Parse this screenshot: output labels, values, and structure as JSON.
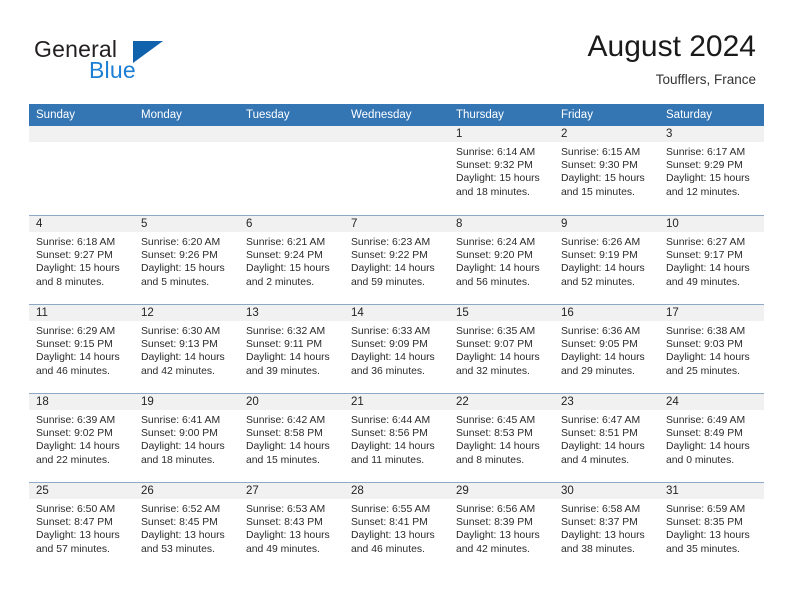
{
  "brand": {
    "name_part1": "General",
    "name_part2": "Blue",
    "logo_icon": "triangle-logo-icon",
    "accent_color": "#1c7fd4",
    "triangle_color": "#1162ad"
  },
  "header": {
    "title": "August 2024",
    "subtitle": "Toufflers, France"
  },
  "calendar": {
    "header_color": "#3475b4",
    "day_number_band_color": "#f1f1f1",
    "weekday_headers": [
      "Sunday",
      "Monday",
      "Tuesday",
      "Wednesday",
      "Thursday",
      "Friday",
      "Saturday"
    ],
    "weeks": [
      [
        {
          "date": "",
          "lines": []
        },
        {
          "date": "",
          "lines": []
        },
        {
          "date": "",
          "lines": []
        },
        {
          "date": "",
          "lines": []
        },
        {
          "date": "1",
          "lines": [
            "Sunrise: 6:14 AM",
            "Sunset: 9:32 PM",
            "Daylight: 15 hours",
            "and 18 minutes."
          ]
        },
        {
          "date": "2",
          "lines": [
            "Sunrise: 6:15 AM",
            "Sunset: 9:30 PM",
            "Daylight: 15 hours",
            "and 15 minutes."
          ]
        },
        {
          "date": "3",
          "lines": [
            "Sunrise: 6:17 AM",
            "Sunset: 9:29 PM",
            "Daylight: 15 hours",
            "and 12 minutes."
          ]
        }
      ],
      [
        {
          "date": "4",
          "lines": [
            "Sunrise: 6:18 AM",
            "Sunset: 9:27 PM",
            "Daylight: 15 hours",
            "and 8 minutes."
          ]
        },
        {
          "date": "5",
          "lines": [
            "Sunrise: 6:20 AM",
            "Sunset: 9:26 PM",
            "Daylight: 15 hours",
            "and 5 minutes."
          ]
        },
        {
          "date": "6",
          "lines": [
            "Sunrise: 6:21 AM",
            "Sunset: 9:24 PM",
            "Daylight: 15 hours",
            "and 2 minutes."
          ]
        },
        {
          "date": "7",
          "lines": [
            "Sunrise: 6:23 AM",
            "Sunset: 9:22 PM",
            "Daylight: 14 hours",
            "and 59 minutes."
          ]
        },
        {
          "date": "8",
          "lines": [
            "Sunrise: 6:24 AM",
            "Sunset: 9:20 PM",
            "Daylight: 14 hours",
            "and 56 minutes."
          ]
        },
        {
          "date": "9",
          "lines": [
            "Sunrise: 6:26 AM",
            "Sunset: 9:19 PM",
            "Daylight: 14 hours",
            "and 52 minutes."
          ]
        },
        {
          "date": "10",
          "lines": [
            "Sunrise: 6:27 AM",
            "Sunset: 9:17 PM",
            "Daylight: 14 hours",
            "and 49 minutes."
          ]
        }
      ],
      [
        {
          "date": "11",
          "lines": [
            "Sunrise: 6:29 AM",
            "Sunset: 9:15 PM",
            "Daylight: 14 hours",
            "and 46 minutes."
          ]
        },
        {
          "date": "12",
          "lines": [
            "Sunrise: 6:30 AM",
            "Sunset: 9:13 PM",
            "Daylight: 14 hours",
            "and 42 minutes."
          ]
        },
        {
          "date": "13",
          "lines": [
            "Sunrise: 6:32 AM",
            "Sunset: 9:11 PM",
            "Daylight: 14 hours",
            "and 39 minutes."
          ]
        },
        {
          "date": "14",
          "lines": [
            "Sunrise: 6:33 AM",
            "Sunset: 9:09 PM",
            "Daylight: 14 hours",
            "and 36 minutes."
          ]
        },
        {
          "date": "15",
          "lines": [
            "Sunrise: 6:35 AM",
            "Sunset: 9:07 PM",
            "Daylight: 14 hours",
            "and 32 minutes."
          ]
        },
        {
          "date": "16",
          "lines": [
            "Sunrise: 6:36 AM",
            "Sunset: 9:05 PM",
            "Daylight: 14 hours",
            "and 29 minutes."
          ]
        },
        {
          "date": "17",
          "lines": [
            "Sunrise: 6:38 AM",
            "Sunset: 9:03 PM",
            "Daylight: 14 hours",
            "and 25 minutes."
          ]
        }
      ],
      [
        {
          "date": "18",
          "lines": [
            "Sunrise: 6:39 AM",
            "Sunset: 9:02 PM",
            "Daylight: 14 hours",
            "and 22 minutes."
          ]
        },
        {
          "date": "19",
          "lines": [
            "Sunrise: 6:41 AM",
            "Sunset: 9:00 PM",
            "Daylight: 14 hours",
            "and 18 minutes."
          ]
        },
        {
          "date": "20",
          "lines": [
            "Sunrise: 6:42 AM",
            "Sunset: 8:58 PM",
            "Daylight: 14 hours",
            "and 15 minutes."
          ]
        },
        {
          "date": "21",
          "lines": [
            "Sunrise: 6:44 AM",
            "Sunset: 8:56 PM",
            "Daylight: 14 hours",
            "and 11 minutes."
          ]
        },
        {
          "date": "22",
          "lines": [
            "Sunrise: 6:45 AM",
            "Sunset: 8:53 PM",
            "Daylight: 14 hours",
            "and 8 minutes."
          ]
        },
        {
          "date": "23",
          "lines": [
            "Sunrise: 6:47 AM",
            "Sunset: 8:51 PM",
            "Daylight: 14 hours",
            "and 4 minutes."
          ]
        },
        {
          "date": "24",
          "lines": [
            "Sunrise: 6:49 AM",
            "Sunset: 8:49 PM",
            "Daylight: 14 hours",
            "and 0 minutes."
          ]
        }
      ],
      [
        {
          "date": "25",
          "lines": [
            "Sunrise: 6:50 AM",
            "Sunset: 8:47 PM",
            "Daylight: 13 hours",
            "and 57 minutes."
          ]
        },
        {
          "date": "26",
          "lines": [
            "Sunrise: 6:52 AM",
            "Sunset: 8:45 PM",
            "Daylight: 13 hours",
            "and 53 minutes."
          ]
        },
        {
          "date": "27",
          "lines": [
            "Sunrise: 6:53 AM",
            "Sunset: 8:43 PM",
            "Daylight: 13 hours",
            "and 49 minutes."
          ]
        },
        {
          "date": "28",
          "lines": [
            "Sunrise: 6:55 AM",
            "Sunset: 8:41 PM",
            "Daylight: 13 hours",
            "and 46 minutes."
          ]
        },
        {
          "date": "29",
          "lines": [
            "Sunrise: 6:56 AM",
            "Sunset: 8:39 PM",
            "Daylight: 13 hours",
            "and 42 minutes."
          ]
        },
        {
          "date": "30",
          "lines": [
            "Sunrise: 6:58 AM",
            "Sunset: 8:37 PM",
            "Daylight: 13 hours",
            "and 38 minutes."
          ]
        },
        {
          "date": "31",
          "lines": [
            "Sunrise: 6:59 AM",
            "Sunset: 8:35 PM",
            "Daylight: 13 hours",
            "and 35 minutes."
          ]
        }
      ]
    ]
  }
}
